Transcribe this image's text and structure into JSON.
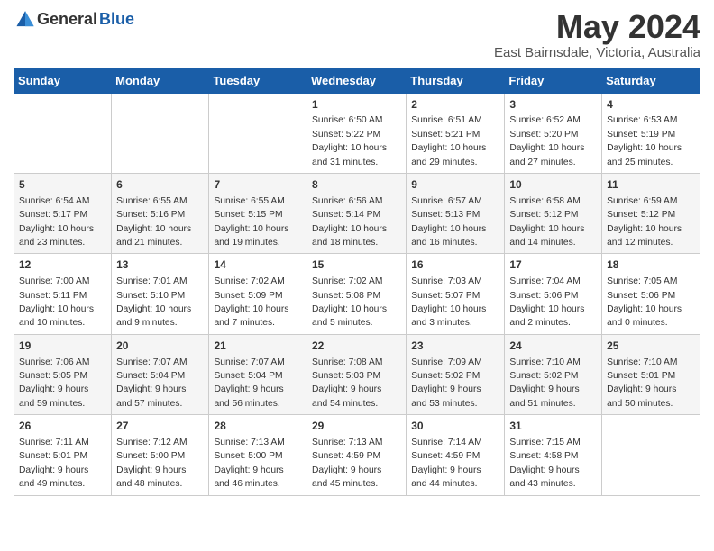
{
  "header": {
    "logo_general": "General",
    "logo_blue": "Blue",
    "title": "May 2024",
    "location": "East Bairnsdale, Victoria, Australia"
  },
  "days_of_week": [
    "Sunday",
    "Monday",
    "Tuesday",
    "Wednesday",
    "Thursday",
    "Friday",
    "Saturday"
  ],
  "weeks": [
    [
      {
        "day": "",
        "info": ""
      },
      {
        "day": "",
        "info": ""
      },
      {
        "day": "",
        "info": ""
      },
      {
        "day": "1",
        "info": "Sunrise: 6:50 AM\nSunset: 5:22 PM\nDaylight: 10 hours\nand 31 minutes."
      },
      {
        "day": "2",
        "info": "Sunrise: 6:51 AM\nSunset: 5:21 PM\nDaylight: 10 hours\nand 29 minutes."
      },
      {
        "day": "3",
        "info": "Sunrise: 6:52 AM\nSunset: 5:20 PM\nDaylight: 10 hours\nand 27 minutes."
      },
      {
        "day": "4",
        "info": "Sunrise: 6:53 AM\nSunset: 5:19 PM\nDaylight: 10 hours\nand 25 minutes."
      }
    ],
    [
      {
        "day": "5",
        "info": "Sunrise: 6:54 AM\nSunset: 5:17 PM\nDaylight: 10 hours\nand 23 minutes."
      },
      {
        "day": "6",
        "info": "Sunrise: 6:55 AM\nSunset: 5:16 PM\nDaylight: 10 hours\nand 21 minutes."
      },
      {
        "day": "7",
        "info": "Sunrise: 6:55 AM\nSunset: 5:15 PM\nDaylight: 10 hours\nand 19 minutes."
      },
      {
        "day": "8",
        "info": "Sunrise: 6:56 AM\nSunset: 5:14 PM\nDaylight: 10 hours\nand 18 minutes."
      },
      {
        "day": "9",
        "info": "Sunrise: 6:57 AM\nSunset: 5:13 PM\nDaylight: 10 hours\nand 16 minutes."
      },
      {
        "day": "10",
        "info": "Sunrise: 6:58 AM\nSunset: 5:12 PM\nDaylight: 10 hours\nand 14 minutes."
      },
      {
        "day": "11",
        "info": "Sunrise: 6:59 AM\nSunset: 5:12 PM\nDaylight: 10 hours\nand 12 minutes."
      }
    ],
    [
      {
        "day": "12",
        "info": "Sunrise: 7:00 AM\nSunset: 5:11 PM\nDaylight: 10 hours\nand 10 minutes."
      },
      {
        "day": "13",
        "info": "Sunrise: 7:01 AM\nSunset: 5:10 PM\nDaylight: 10 hours\nand 9 minutes."
      },
      {
        "day": "14",
        "info": "Sunrise: 7:02 AM\nSunset: 5:09 PM\nDaylight: 10 hours\nand 7 minutes."
      },
      {
        "day": "15",
        "info": "Sunrise: 7:02 AM\nSunset: 5:08 PM\nDaylight: 10 hours\nand 5 minutes."
      },
      {
        "day": "16",
        "info": "Sunrise: 7:03 AM\nSunset: 5:07 PM\nDaylight: 10 hours\nand 3 minutes."
      },
      {
        "day": "17",
        "info": "Sunrise: 7:04 AM\nSunset: 5:06 PM\nDaylight: 10 hours\nand 2 minutes."
      },
      {
        "day": "18",
        "info": "Sunrise: 7:05 AM\nSunset: 5:06 PM\nDaylight: 10 hours\nand 0 minutes."
      }
    ],
    [
      {
        "day": "19",
        "info": "Sunrise: 7:06 AM\nSunset: 5:05 PM\nDaylight: 9 hours\nand 59 minutes."
      },
      {
        "day": "20",
        "info": "Sunrise: 7:07 AM\nSunset: 5:04 PM\nDaylight: 9 hours\nand 57 minutes."
      },
      {
        "day": "21",
        "info": "Sunrise: 7:07 AM\nSunset: 5:04 PM\nDaylight: 9 hours\nand 56 minutes."
      },
      {
        "day": "22",
        "info": "Sunrise: 7:08 AM\nSunset: 5:03 PM\nDaylight: 9 hours\nand 54 minutes."
      },
      {
        "day": "23",
        "info": "Sunrise: 7:09 AM\nSunset: 5:02 PM\nDaylight: 9 hours\nand 53 minutes."
      },
      {
        "day": "24",
        "info": "Sunrise: 7:10 AM\nSunset: 5:02 PM\nDaylight: 9 hours\nand 51 minutes."
      },
      {
        "day": "25",
        "info": "Sunrise: 7:10 AM\nSunset: 5:01 PM\nDaylight: 9 hours\nand 50 minutes."
      }
    ],
    [
      {
        "day": "26",
        "info": "Sunrise: 7:11 AM\nSunset: 5:01 PM\nDaylight: 9 hours\nand 49 minutes."
      },
      {
        "day": "27",
        "info": "Sunrise: 7:12 AM\nSunset: 5:00 PM\nDaylight: 9 hours\nand 48 minutes."
      },
      {
        "day": "28",
        "info": "Sunrise: 7:13 AM\nSunset: 5:00 PM\nDaylight: 9 hours\nand 46 minutes."
      },
      {
        "day": "29",
        "info": "Sunrise: 7:13 AM\nSunset: 4:59 PM\nDaylight: 9 hours\nand 45 minutes."
      },
      {
        "day": "30",
        "info": "Sunrise: 7:14 AM\nSunset: 4:59 PM\nDaylight: 9 hours\nand 44 minutes."
      },
      {
        "day": "31",
        "info": "Sunrise: 7:15 AM\nSunset: 4:58 PM\nDaylight: 9 hours\nand 43 minutes."
      },
      {
        "day": "",
        "info": ""
      }
    ]
  ]
}
